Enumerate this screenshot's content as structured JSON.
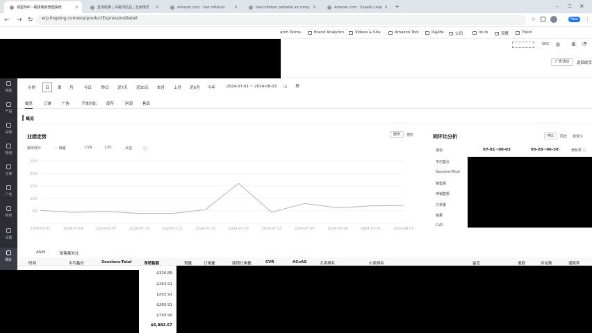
{
  "browser": {
    "tabs": [
      {
        "title": "领星ERP - 跨境电商管理系统",
        "active": true
      },
      {
        "title": "查询结果 | 关键词优品 | 查家精灵",
        "active": false
      },
      {
        "title": "Amazon.com : fast inflation",
        "active": false
      },
      {
        "title": "fast inflation portable air comp",
        "active": false
      },
      {
        "title": "Amazon.com : Superb Leap",
        "active": false
      }
    ],
    "url": "erp.lingxing.com/erp/productExpressionDetail",
    "bookmarks": [
      {
        "label": "arch Terms"
      },
      {
        "label": "Brand Analytics"
      },
      {
        "label": "Videos & Site"
      },
      {
        "label": "Amazon Tool"
      },
      {
        "label": "PayPal"
      },
      {
        "label": "公司"
      },
      {
        "label": "Ini.io"
      },
      {
        "label": "百度"
      },
      {
        "label": "Trello"
      }
    ],
    "profile_label": "New",
    "window_controls": [
      "–",
      "□",
      "×"
    ]
  },
  "header": {
    "right_tag": "SPIC",
    "action_buttons": [
      "广告活动",
      "返回前页"
    ]
  },
  "sidebar": {
    "items": [
      {
        "label": "销售"
      },
      {
        "label": "产品"
      },
      {
        "label": "采购"
      },
      {
        "label": "物流"
      },
      {
        "label": "仓库"
      },
      {
        "label": "广告"
      },
      {
        "label": "财务"
      },
      {
        "label": "设置"
      },
      {
        "label": "统计"
      }
    ]
  },
  "filters": {
    "range_units": [
      "小时",
      "日",
      "周",
      "月"
    ],
    "quick_ranges": [
      "今日",
      "昨日",
      "近7天",
      "近30天",
      "本月",
      "上月",
      "近6月",
      "今年"
    ],
    "date_range": "2024-07-01 ~ 2024-08-03"
  },
  "subtabs": [
    "概览",
    "订单",
    "广告",
    "子体对比",
    "库存",
    "利润",
    "售后"
  ],
  "overview_label": "概览",
  "trend": {
    "title": "业绩走势",
    "toggle": [
      "按天",
      "按时"
    ],
    "legend": [
      "按天统计",
      "销量",
      "CVR",
      "CPC",
      "点击"
    ],
    "info_icon": "info-icon"
  },
  "chart_data": {
    "type": "line",
    "x": [
      "2024-07-01",
      "2024-07-04",
      "2024-07-07",
      "2024-07-10",
      "2024-07-13",
      "2024-07-16",
      "2024-07-19",
      "2024-07-22",
      "2024-07-25",
      "2024-07-28",
      "2024-07-31",
      "2024-08-03"
    ],
    "series": [
      {
        "values": [
          52,
          44,
          48,
          40,
          40,
          55,
          160,
          45,
          80,
          62,
          70,
          72
        ]
      }
    ],
    "y_ticks": [
      "250",
      "200",
      "150",
      "100",
      "50",
      ""
    ],
    "ylim": [
      0,
      250
    ],
    "grid": true,
    "color": "#b0b4ba"
  },
  "compare": {
    "title": "同环比分析",
    "toggle": [
      "环比",
      "同比",
      "自定义"
    ],
    "col1": "07-01~08-03",
    "col2": "05-28~06-30",
    "col3": "增长率",
    "rows": [
      "平均售价",
      "Sessions-Total",
      "销售额",
      "净销售额",
      "订单量",
      "销量",
      "CVR"
    ]
  },
  "table": {
    "tabs": [
      "ASIN",
      "销售额对比"
    ],
    "headers": [
      "时间",
      "平均售价",
      "Sessions-Total",
      "净销售额",
      "销量",
      "订单量",
      "促销订单量",
      "CVR",
      "ACoAS",
      "大类排名",
      "小类排名",
      "留言",
      "退款",
      "评论数",
      "退款率"
    ],
    "net_sales": [
      "$326.89",
      "$263.91",
      "$263.91",
      "$260.91",
      "$793.90"
    ],
    "total": "$6,882.57"
  }
}
